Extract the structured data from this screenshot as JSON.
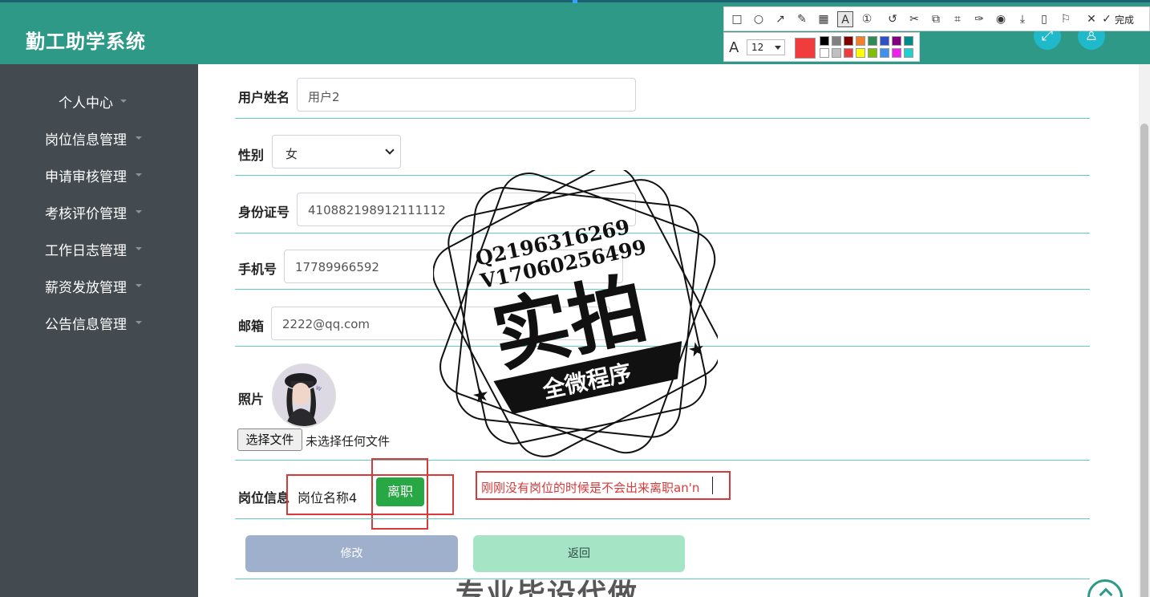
{
  "app": {
    "title": "勤工助学系统"
  },
  "header_buttons": [
    {
      "icon": "expand-icon",
      "glyph": "⤢"
    },
    {
      "icon": "user-icon",
      "glyph": "♙"
    }
  ],
  "sidebar": {
    "items": [
      {
        "label": "个人中心"
      },
      {
        "label": "岗位信息管理"
      },
      {
        "label": "申请审核管理"
      },
      {
        "label": "考核评价管理"
      },
      {
        "label": "工作日志管理"
      },
      {
        "label": "薪资发放管理"
      },
      {
        "label": "公告信息管理"
      }
    ]
  },
  "form": {
    "username": {
      "label": "用户姓名",
      "value": "用户2"
    },
    "gender": {
      "label": "性别",
      "value": "女"
    },
    "id_card": {
      "label": "身份证号",
      "value": "410882198912111112"
    },
    "phone": {
      "label": "手机号",
      "value": "17789966592"
    },
    "email": {
      "label": "邮箱",
      "value": "2222@qq.com"
    },
    "photo": {
      "label": "照片",
      "file_button": "选择文件",
      "file_status": "未选择任何文件"
    },
    "post": {
      "label": "岗位信息",
      "value": "岗位名称4",
      "resign_button": "离职"
    },
    "annotation_note": "刚刚没有岗位的时候是不会出来离职an'n",
    "buttons": {
      "edit": "修改",
      "back": "返回"
    }
  },
  "watermark": {
    "line1": "Q2196316269",
    "line2": "V17060256499",
    "main": "实拍",
    "banner": "全微程序",
    "bottom": "专业毕设代做"
  },
  "snip_toolbar": {
    "tools": [
      "rect-tool-icon",
      "ellipse-tool-icon",
      "arrow-tool-icon",
      "pen-tool-icon",
      "mosaic-tool-icon",
      "text-tool-icon",
      "number-tool-icon",
      "undo-icon",
      "cut-icon",
      "ocr-icon",
      "scan-icon",
      "pin-icon",
      "record-icon",
      "download-icon",
      "phone-icon",
      "bookmark-icon",
      "close-icon"
    ],
    "done_label": "完成",
    "font_size": "12",
    "current_color": "#f03c3c",
    "palette_top": [
      "#000000",
      "#808080",
      "#800000",
      "#f08030",
      "#2e8b57",
      "#3050c8",
      "#800080",
      "#008b8b"
    ],
    "palette_bottom": [
      "#ffffff",
      "#c0c0c0",
      "#f03c3c",
      "#ffff00",
      "#80c000",
      "#4090f0",
      "#f020f0",
      "#20d0d0"
    ]
  }
}
